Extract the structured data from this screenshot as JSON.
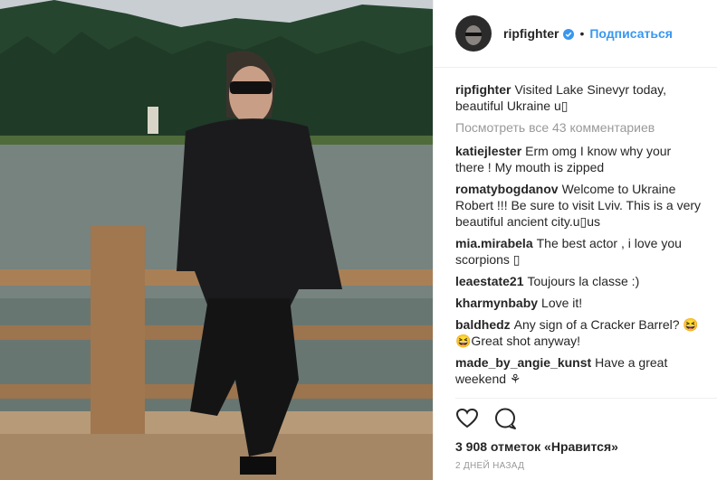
{
  "header": {
    "username": "ripfighter",
    "separator": "•",
    "follow_label": "Подписаться"
  },
  "caption": {
    "username": "ripfighter",
    "text": "Visited Lake Sinevyr today, beautiful Ukraine u⁠▯"
  },
  "view_all_label": "Посмотреть все 43 комментариев",
  "comments": [
    {
      "username": "katiejlester",
      "text": "Erm omg I know why your there ! My mouth is zipped"
    },
    {
      "username": "romatybogdanov",
      "text": "Welcome to Ukraine Robert !!! Be sure to visit Lviv. This is a very beautiful ancient city.u▯us"
    },
    {
      "username": "mia.mirabela",
      "text": "The best actor , i love you scorpions ▯"
    },
    {
      "username": "leaestate21",
      "text": "Toujours la classe :)"
    },
    {
      "username": "kharmynbaby",
      "text": "Love it!"
    },
    {
      "username": "baldhedz",
      "text": "Any sign of a Cracker Barrel? 😆 😆Great shot anyway!"
    },
    {
      "username": "made_by_angie_kunst",
      "text": "Have a great weekend ⚘"
    }
  ],
  "likes_label": "3 908 отметок «Нравится»",
  "time_label": "2 дней назад",
  "icons": {
    "like": "heart-icon",
    "comment": "comment-icon",
    "verified": "verified-badge-icon"
  },
  "colors": {
    "link": "#3897f0",
    "muted": "#999999",
    "text": "#262626"
  }
}
